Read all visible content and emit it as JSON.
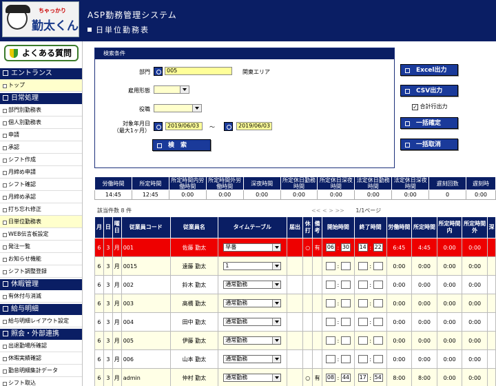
{
  "app": {
    "logo_small": "ちゃっかり",
    "logo_big": "勤太くん",
    "title": "ASP勤務管理システム",
    "page_title": "日単位勤務表"
  },
  "sidebar": {
    "faq_label": "よくある質問",
    "sections": [
      {
        "title": "エントランス",
        "items": [
          {
            "label": "トップ",
            "active": true
          }
        ]
      },
      {
        "title": "日常処理",
        "items": [
          {
            "label": "部門別勤務表"
          },
          {
            "label": "個人別勤務表"
          },
          {
            "label": "申請"
          },
          {
            "label": "承認"
          },
          {
            "label": "シフト作成"
          },
          {
            "label": "月締め申請"
          },
          {
            "label": "シフト確認"
          },
          {
            "label": "月締め承認"
          },
          {
            "label": "打ち忘れ修正"
          },
          {
            "label": "日単位勤務表",
            "active": true
          },
          {
            "label": "WEB伝言板設定"
          },
          {
            "label": "発注一覧"
          },
          {
            "label": "お知らせ機能"
          },
          {
            "label": "シフト調整登録"
          }
        ]
      },
      {
        "title": "休暇管理",
        "items": [
          {
            "label": "有休付与消滅"
          }
        ]
      },
      {
        "title": "給与明細",
        "items": [
          {
            "label": "給与明細レイアウト設定"
          }
        ]
      },
      {
        "title": "照会・外部連携",
        "items": [
          {
            "label": "出退勤場所確認"
          },
          {
            "label": "休暇実績確認"
          },
          {
            "label": "勤怠明細集計データ"
          },
          {
            "label": "シフト取込"
          }
        ]
      }
    ]
  },
  "search": {
    "header": "検索条件",
    "dept_label": "部門",
    "dept_value": "005",
    "dept_name": "関東エリア",
    "emptype_label": "雇用形態",
    "post_label": "役職",
    "period_label_1": "対象年月日",
    "period_label_2": "（最大1ヶ月）",
    "date_from": "2019/06/03",
    "date_sep": "～",
    "date_to": "2019/06/03",
    "search_button": "検　索"
  },
  "actions": {
    "excel": "Excel出力",
    "csv": "CSV出力",
    "total_row_label": "合計行出力",
    "total_row_checked": true,
    "bulk_confirm": "一括確定",
    "bulk_cancel": "一括取消"
  },
  "summary": {
    "headers": [
      "労働時間",
      "所定時間",
      "所定時間内労働時間",
      "所定時間外労働時間",
      "深夜時間",
      "所定休日勤務時間",
      "所定休日深夜時間",
      "法定休日勤務時間",
      "法定休日深夜時間",
      "遅刻回数",
      "遅刻時"
    ],
    "values": [
      "14:45",
      "12:45",
      "0:00",
      "0:00",
      "0:00",
      "0:00",
      "0:00",
      "0:00",
      "0:00",
      "0",
      "0:00"
    ]
  },
  "list": {
    "count_label": "該当件数 8 件",
    "pager_nav": "<< < > >>",
    "page_label": "1/1ページ",
    "headers": [
      "月",
      "日",
      "曜日",
      "従業員コード",
      "従業員名",
      "タイムテーブル",
      "届出",
      "休打",
      "備考",
      "開始時間",
      "終了時間",
      "労働時間",
      "所定時間",
      "所定時間内",
      "所定時間外",
      "深"
    ],
    "rows": [
      {
        "m": "6",
        "d": "3",
        "w": "月",
        "code": "001",
        "name": "佐藤 勤太",
        "tt": "早番",
        "todoke": "",
        "kyu": "○",
        "biko": "有",
        "sh": "06",
        "sm": "30",
        "eh": "14",
        "em": "22",
        "work": "6:45",
        "sotei": "4:45",
        "nai": "0:00",
        "gai": "0:00",
        "style": "red"
      },
      {
        "m": "6",
        "d": "3",
        "w": "月",
        "code": "0015",
        "name": "遠藤 勤太",
        "tt": "1",
        "todoke": "",
        "kyu": "",
        "biko": "",
        "sh": "",
        "sm": "",
        "eh": "",
        "em": "",
        "work": "0:00",
        "sotei": "0:00",
        "nai": "0:00",
        "gai": "0:00",
        "style": "odd"
      },
      {
        "m": "6",
        "d": "3",
        "w": "月",
        "code": "002",
        "name": "鈴木 勤太",
        "tt": "通常勤務",
        "todoke": "",
        "kyu": "",
        "biko": "",
        "sh": "",
        "sm": "",
        "eh": "",
        "em": "",
        "work": "0:00",
        "sotei": "0:00",
        "nai": "0:00",
        "gai": "0:00",
        "style": "even"
      },
      {
        "m": "6",
        "d": "3",
        "w": "月",
        "code": "003",
        "name": "高橋 勤太",
        "tt": "通常勤務",
        "todoke": "",
        "kyu": "",
        "biko": "",
        "sh": "",
        "sm": "",
        "eh": "",
        "em": "",
        "work": "0:00",
        "sotei": "0:00",
        "nai": "0:00",
        "gai": "0:00",
        "style": "odd"
      },
      {
        "m": "6",
        "d": "3",
        "w": "月",
        "code": "004",
        "name": "田中 勤太",
        "tt": "通常勤務",
        "todoke": "",
        "kyu": "",
        "biko": "",
        "sh": "",
        "sm": "",
        "eh": "",
        "em": "",
        "work": "0:00",
        "sotei": "0:00",
        "nai": "0:00",
        "gai": "0:00",
        "style": "even"
      },
      {
        "m": "6",
        "d": "3",
        "w": "月",
        "code": "005",
        "name": "伊藤 勤太",
        "tt": "通常勤務",
        "todoke": "",
        "kyu": "",
        "biko": "",
        "sh": "",
        "sm": "",
        "eh": "",
        "em": "",
        "work": "0:00",
        "sotei": "0:00",
        "nai": "0:00",
        "gai": "0:00",
        "style": "odd"
      },
      {
        "m": "6",
        "d": "3",
        "w": "月",
        "code": "006",
        "name": "山本 勤太",
        "tt": "通常勤務",
        "todoke": "",
        "kyu": "",
        "biko": "",
        "sh": "",
        "sm": "",
        "eh": "",
        "em": "",
        "work": "0:00",
        "sotei": "0:00",
        "nai": "0:00",
        "gai": "0:00",
        "style": "even"
      },
      {
        "m": "6",
        "d": "3",
        "w": "月",
        "code": "admin",
        "name": "仲村 勤太",
        "tt": "通常勤務",
        "todoke": "",
        "kyu": "○",
        "biko": "有",
        "sh": "08",
        "sm": "44",
        "eh": "17",
        "em": "54",
        "work": "8:00",
        "sotei": "8:00",
        "nai": "0:00",
        "gai": "0:00",
        "style": "odd"
      }
    ]
  }
}
